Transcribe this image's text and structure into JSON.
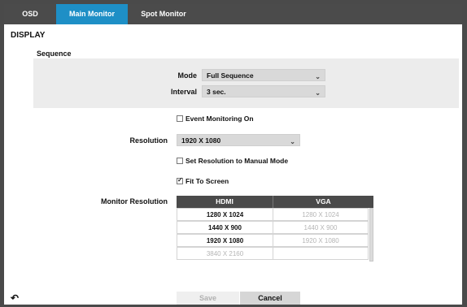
{
  "tabs": [
    {
      "label": "OSD"
    },
    {
      "label": "Main Monitor"
    },
    {
      "label": "Spot Monitor"
    }
  ],
  "active_tab_color": "#1e8fc6",
  "section_title": "DISPLAY",
  "sequence": {
    "title": "Sequence",
    "mode_label": "Mode",
    "mode_value": "Full Sequence",
    "interval_label": "Interval",
    "interval_value": "3 sec."
  },
  "event_monitoring": {
    "label": "Event Monitoring On",
    "checked": false
  },
  "resolution": {
    "label": "Resolution",
    "value": "1920 X 1080"
  },
  "manual_mode": {
    "label": "Set Resolution to Manual Mode",
    "checked": false
  },
  "fit_to_screen": {
    "label": "Fit To Screen",
    "checked": true
  },
  "monitor_resolution": {
    "label": "Monitor Resolution",
    "columns": [
      "HDMI",
      "VGA"
    ],
    "rows": [
      {
        "hdmi": "1280 X 1024",
        "vga": "1280 X 1024",
        "hdmi_enabled": true,
        "vga_enabled": false
      },
      {
        "hdmi": "1440 X 900",
        "vga": "1440 X 900",
        "hdmi_enabled": true,
        "vga_enabled": false
      },
      {
        "hdmi": "1920 X 1080",
        "vga": "1920 X 1080",
        "hdmi_enabled": true,
        "vga_enabled": false
      },
      {
        "hdmi": "3840 X 2160",
        "vga": "",
        "hdmi_enabled": false,
        "vga_enabled": false
      }
    ]
  },
  "buttons": {
    "save": "Save",
    "cancel": "Cancel"
  },
  "icons": {
    "back": "back-arrow-icon",
    "dropdown": "chevron-down-icon",
    "checkbox": "checkbox-icon"
  }
}
